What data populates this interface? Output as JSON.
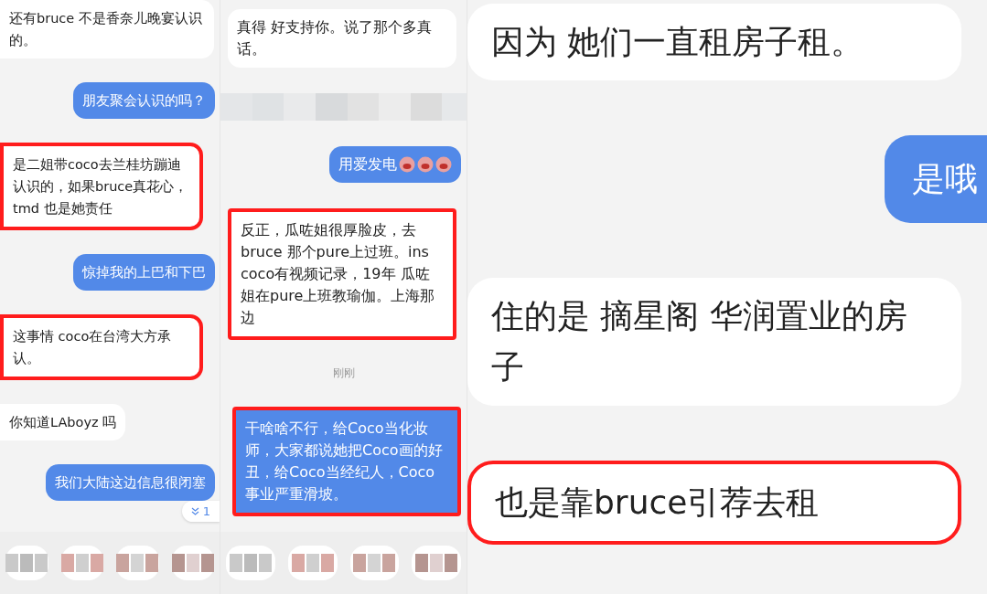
{
  "panels": [
    {
      "unread_badge": "1",
      "blurred_toolbar": true,
      "messages": [
        {
          "kind": "message",
          "outgoing": false,
          "highlighted": false,
          "text": "还有bruce 不是香奈儿晚宴认识的。"
        },
        {
          "kind": "message",
          "outgoing": true,
          "highlighted": false,
          "text": "朋友聚会认识的吗？"
        },
        {
          "kind": "message",
          "outgoing": false,
          "highlighted": true,
          "text": "是二姐带coco去兰桂坊蹦迪认识的，如果bruce真花心，tmd 也是她责任"
        },
        {
          "kind": "message",
          "outgoing": true,
          "highlighted": false,
          "text": "惊掉我的上巴和下巴"
        },
        {
          "kind": "message",
          "outgoing": false,
          "highlighted": true,
          "text": "这事情 coco在台湾大方承认。"
        },
        {
          "kind": "message",
          "outgoing": false,
          "highlighted": false,
          "text": "你知道LAboyz 吗"
        },
        {
          "kind": "message",
          "outgoing": true,
          "highlighted": false,
          "text": "我们大陆这边信息很闭塞"
        }
      ]
    },
    {
      "blurred_toolbar": true,
      "messages": [
        {
          "kind": "message",
          "outgoing": false,
          "highlighted": false,
          "text": "真得 好支持你。说了那个多真话。"
        },
        {
          "kind": "blurred"
        },
        {
          "kind": "message",
          "outgoing": true,
          "highlighted": false,
          "text": "用爱发电",
          "stickers": [
            {
              "kind": "emoji"
            },
            {
              "kind": "emoji"
            },
            {
              "kind": "emoji"
            }
          ]
        },
        {
          "kind": "message",
          "outgoing": false,
          "highlighted": true,
          "text": "反正，瓜咗姐很厚脸皮，去bruce 那个pure上过班。ins coco有视频记录，19年 瓜咗姐在pure上班教瑜伽。上海那边"
        },
        {
          "kind": "time",
          "text": "刚刚"
        },
        {
          "kind": "message",
          "outgoing": true,
          "highlighted": true,
          "text": "干啥啥不行，给Coco当化妆师，大家都说她把Coco画的好丑，给Coco当经纪人，Coco事业严重滑坡。"
        }
      ]
    },
    {
      "blurred_toolbar": false,
      "messages": [
        {
          "kind": "message",
          "outgoing": false,
          "highlighted": false,
          "text": "因为 她们一直租房子租。"
        },
        {
          "kind": "message",
          "outgoing": true,
          "highlighted": false,
          "text": "是哦"
        },
        {
          "kind": "message",
          "outgoing": false,
          "highlighted": false,
          "text": "住的是 摘星阁 华润置业的房子"
        },
        {
          "kind": "message",
          "outgoing": false,
          "highlighted": true,
          "text": "也是靠bruce引荐去租"
        }
      ]
    }
  ]
}
